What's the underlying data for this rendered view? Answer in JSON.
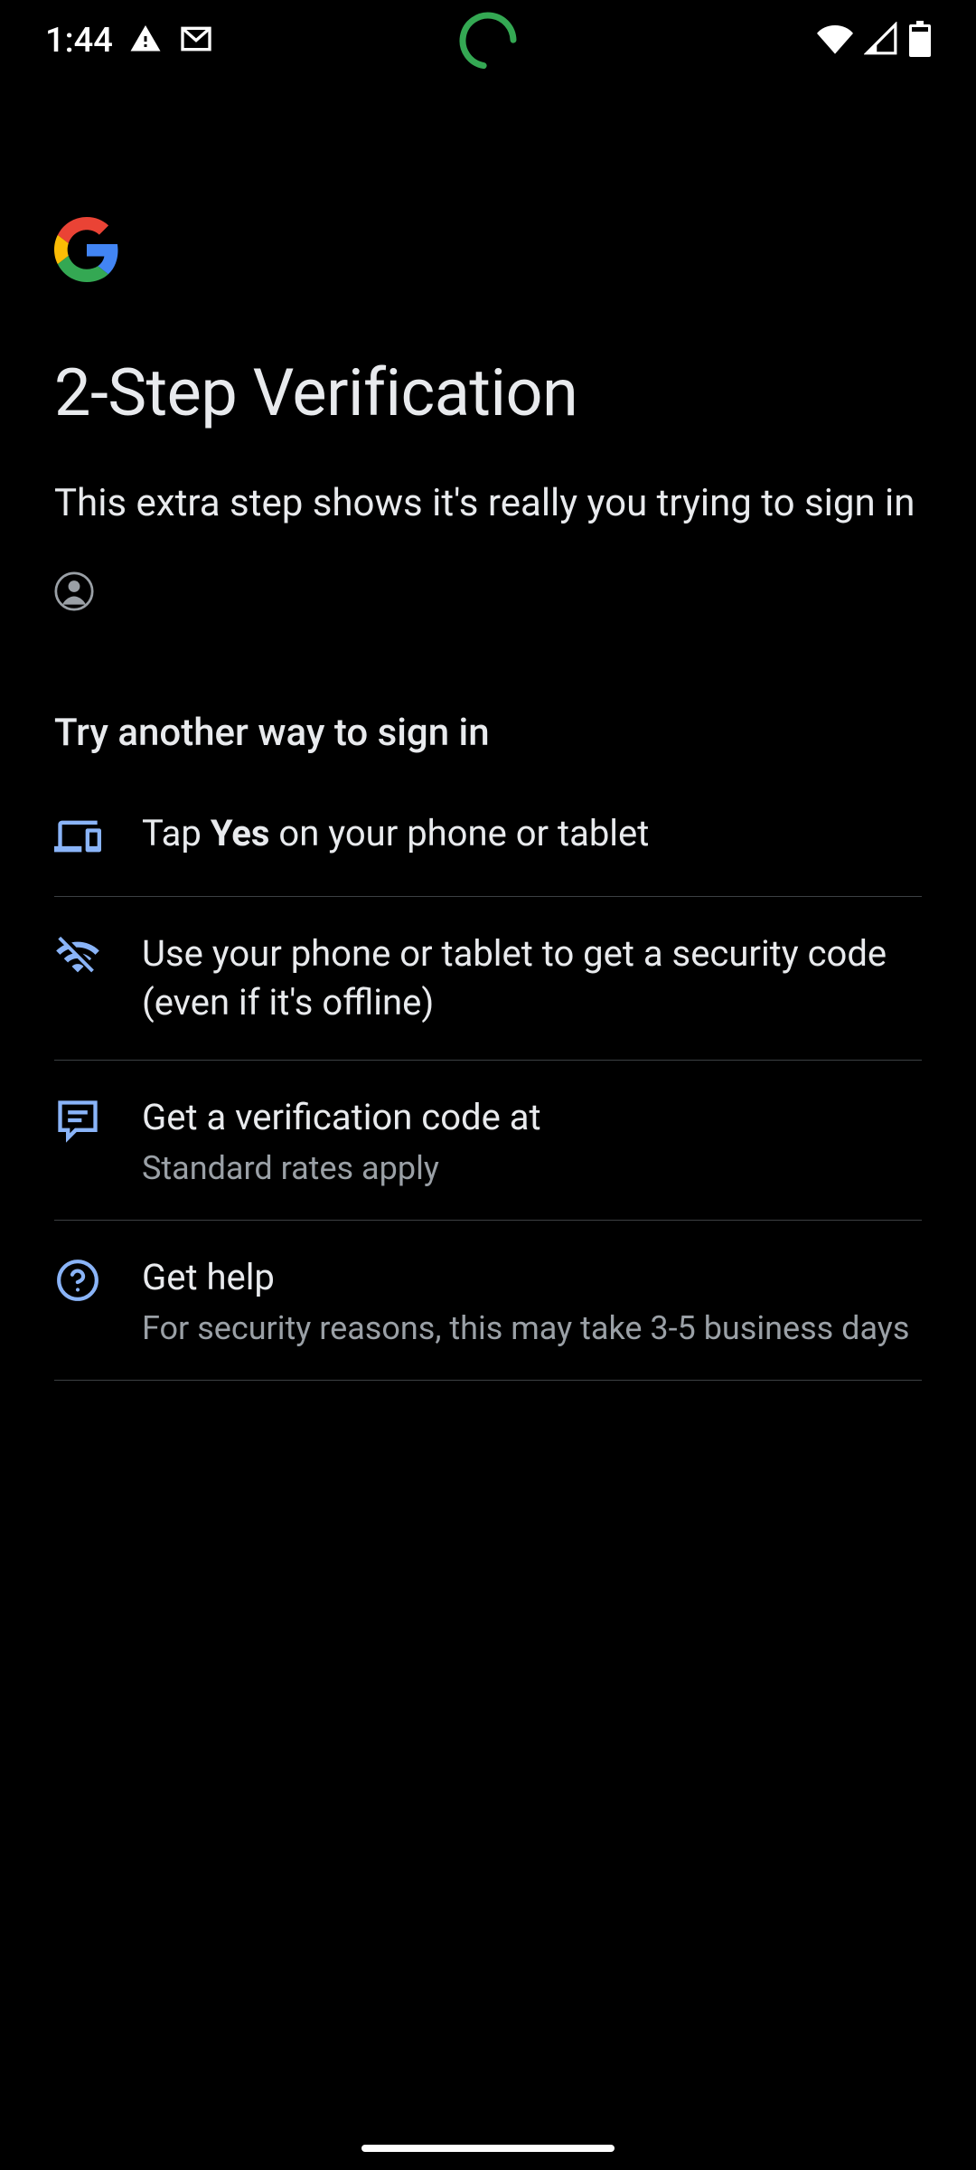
{
  "status_bar": {
    "time": "1:44"
  },
  "header": {
    "title": "2-Step Verification",
    "subtitle": "This extra step shows it's really you trying to sign in"
  },
  "section": {
    "heading": "Try another way to sign in"
  },
  "options": [
    {
      "icon": "devices-icon",
      "label_pre": "Tap ",
      "label_bold": "Yes",
      "label_post": " on your phone or tablet",
      "sub": ""
    },
    {
      "icon": "wifi-off-icon",
      "label_pre": "Use your phone or tablet to get a security code (even if it's offline)",
      "label_bold": "",
      "label_post": "",
      "sub": ""
    },
    {
      "icon": "message-icon",
      "label_pre": "Get a verification code at",
      "label_bold": "",
      "label_post": "",
      "sub": "Standard rates apply"
    },
    {
      "icon": "help-icon",
      "label_pre": "Get help",
      "label_bold": "",
      "label_post": "",
      "sub": "For security reasons, this may take 3-5 business days"
    }
  ],
  "colors": {
    "accent": "#8ab4f8",
    "spinner": "#34a853"
  }
}
